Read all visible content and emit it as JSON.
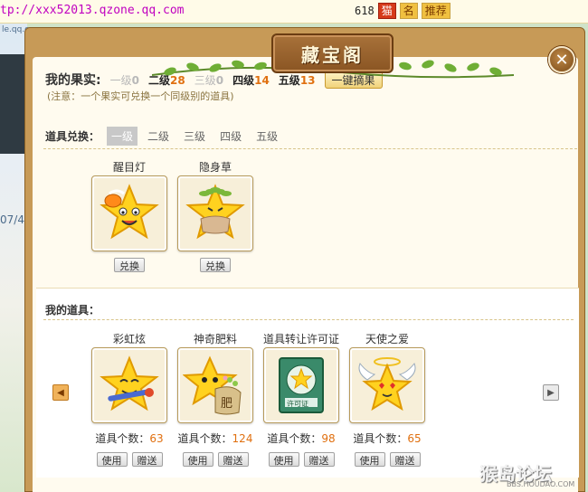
{
  "background": {
    "url_text": "tp://xxx52013.qzone.qq.com",
    "number_fragment": "618",
    "tags": [
      "猫",
      "名",
      "推荐"
    ],
    "left_fragment": "07/4",
    "left_top_fragment": "le.qq.com"
  },
  "dialog": {
    "title": "藏宝阁",
    "close_symbol": "✕"
  },
  "fruit": {
    "label": "我的果实:",
    "levels": [
      {
        "name": "一级",
        "count": "0"
      },
      {
        "name": "二级",
        "count": "28"
      },
      {
        "name": "三级",
        "count": "0"
      },
      {
        "name": "四级",
        "count": "14"
      },
      {
        "name": "五级",
        "count": "13"
      }
    ],
    "pick_button": "一键摘果",
    "note": "(注意：一个果实可兑换一个同级别的道具)"
  },
  "exchange": {
    "label": "道具兑换：",
    "tabs": [
      "一级",
      "二级",
      "三级",
      "四级",
      "五级"
    ],
    "active_tab": "一级",
    "items": [
      {
        "name": "醒目灯",
        "icon": "star-lamp-icon",
        "button": "兑换"
      },
      {
        "name": "隐身草",
        "icon": "star-grass-icon",
        "button": "兑换"
      }
    ]
  },
  "mine": {
    "label": "我的道具：",
    "count_label": "道具个数：",
    "use_button": "使用",
    "gift_button": "赠送",
    "items": [
      {
        "name": "彩虹炫",
        "icon": "star-paintbrush-icon",
        "count": "63"
      },
      {
        "name": "神奇肥料",
        "icon": "star-fertilizer-icon",
        "count": "124"
      },
      {
        "name": "道具转让许可证",
        "icon": "transfer-license-icon",
        "count": "98"
      },
      {
        "name": "天使之爱",
        "icon": "angel-star-icon",
        "count": "65"
      }
    ]
  },
  "watermark": {
    "main": "猴岛论坛",
    "sub": "BBS.HOUDAO.COM"
  }
}
